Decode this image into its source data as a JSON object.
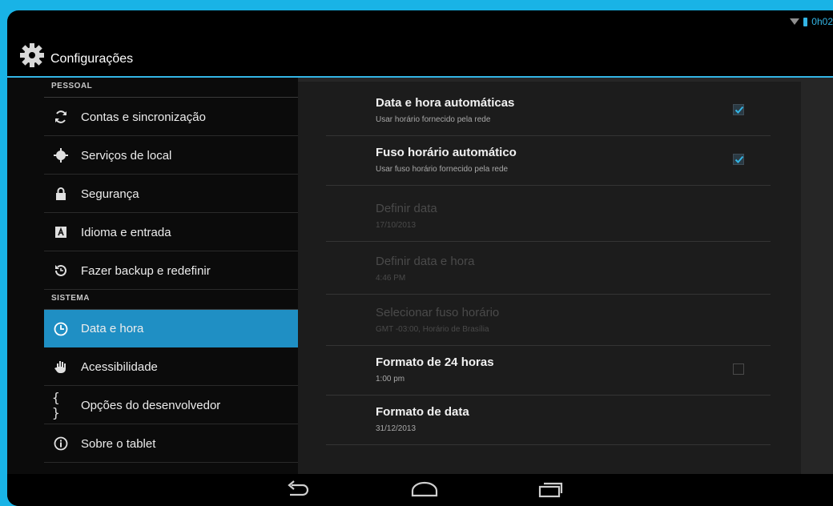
{
  "status": {
    "time": "0h02"
  },
  "actionbar": {
    "title": "Configurações",
    "icon": "settings-gear-icon"
  },
  "sections": {
    "personal": "PESSOAL",
    "system": "SISTEMA"
  },
  "nav": [
    {
      "label": "Contas e sincronização",
      "icon": "sync-icon"
    },
    {
      "label": "Serviços de local",
      "icon": "location-icon"
    },
    {
      "label": "Segurança",
      "icon": "lock-icon"
    },
    {
      "label": "Idioma e entrada",
      "icon": "language-icon"
    },
    {
      "label": "Fazer backup e redefinir",
      "icon": "backup-icon"
    },
    {
      "label": "Data e hora",
      "icon": "clock-icon",
      "selected": true
    },
    {
      "label": "Acessibilidade",
      "icon": "hand-icon"
    },
    {
      "label": "Opções do desenvolvedor",
      "icon": "braces-icon"
    },
    {
      "label": "Sobre o tablet",
      "icon": "info-icon"
    }
  ],
  "prefs": [
    {
      "title": "Data e hora automáticas",
      "summary": "Usar horário fornecido pela rede",
      "checked": true,
      "enabled": true
    },
    {
      "title": "Fuso horário automático",
      "summary": "Usar fuso horário fornecido pela rede",
      "checked": true,
      "enabled": true
    },
    {
      "title": "Definir data",
      "summary": "17/10/2013",
      "enabled": false
    },
    {
      "title": "Definir data e hora",
      "summary": "4:46 PM",
      "enabled": false
    },
    {
      "title": "Selecionar fuso horário",
      "summary": "GMT -03:00, Horário de Brasília",
      "enabled": false
    },
    {
      "title": "Formato de 24 horas",
      "summary": "1:00 pm",
      "checked": false,
      "enabled": true
    },
    {
      "title": "Formato de data",
      "summary": "31/12/2013",
      "enabled": true
    }
  ],
  "colors": {
    "accent": "#33b5e5",
    "selected": "#1f8fc4",
    "frame": "#19b3e6"
  }
}
